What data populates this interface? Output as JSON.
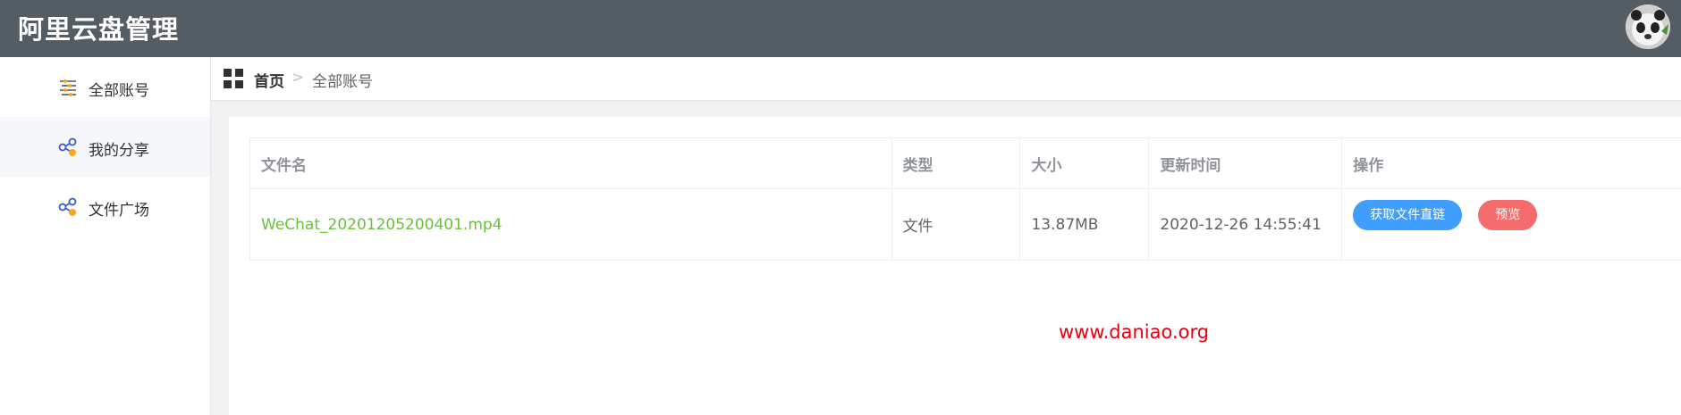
{
  "app": {
    "title": "阿里云盘管理"
  },
  "sidebar": {
    "items": [
      {
        "label": "全部账号",
        "icon": "list-settings-icon"
      },
      {
        "label": "我的分享",
        "icon": "share-icon"
      },
      {
        "label": "文件广场",
        "icon": "share-icon"
      }
    ],
    "active_index": 1
  },
  "breadcrumb": {
    "home": "首页",
    "separator": ">",
    "current": "全部账号"
  },
  "table": {
    "columns": [
      "文件名",
      "类型",
      "大小",
      "更新时间",
      "操作"
    ],
    "rows": [
      {
        "name": "WeChat_20201205200401.mp4",
        "type": "文件",
        "size": "13.87MB",
        "updated": "2020-12-26 14:55:41",
        "actions": [
          "获取文件直链",
          "预览"
        ]
      }
    ]
  },
  "watermark": "www.daniao.org",
  "colors": {
    "header_bg": "#545c64",
    "link_green": "#67c23a",
    "primary": "#409eff",
    "danger": "#f56c6c",
    "watermark": "#e60012"
  }
}
